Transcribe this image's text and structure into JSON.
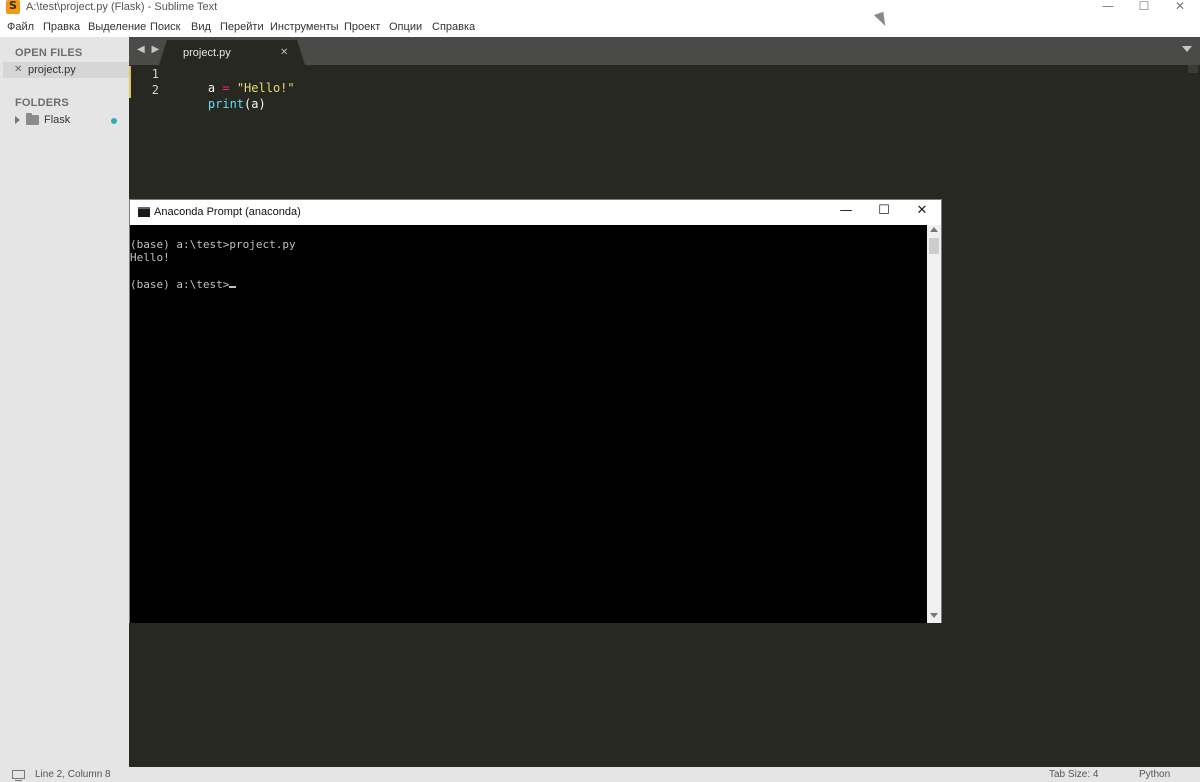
{
  "window": {
    "title": "A:\\test\\project.py (Flask) - Sublime Text",
    "minimize_glyph": "—",
    "maximize_glyph": "☐",
    "close_glyph": "✕",
    "icon": "sublime-text-icon"
  },
  "menu": {
    "items": [
      "Файл",
      "Правка",
      "Выделение",
      "Поиск",
      "Вид",
      "Перейти",
      "Инструменты",
      "Проект",
      "Опции",
      "Справка"
    ]
  },
  "sidebar": {
    "open_files_heading": "OPEN FILES",
    "open_files": [
      {
        "close_glyph": "✕",
        "name": "project.py"
      }
    ],
    "folders_heading": "FOLDERS",
    "folders": [
      {
        "name": "Flask",
        "icon": "folder-icon",
        "status_color": "#33aabb"
      }
    ]
  },
  "tabbar": {
    "nav_glyph": "◀ ▶",
    "tabs": [
      {
        "label": "project.py",
        "close_glyph": "✕",
        "active": true
      }
    ],
    "menu_icon": "chevron-down-icon"
  },
  "editor": {
    "line_numbers": [
      "1",
      "2"
    ],
    "lines": [
      [
        {
          "text": "a ",
          "kind": "plain"
        },
        {
          "text": "=",
          "kind": "op"
        },
        {
          "text": " ",
          "kind": "plain"
        },
        {
          "text": "\"Hello!\"",
          "kind": "str"
        }
      ],
      [
        {
          "text": "print",
          "kind": "fn"
        },
        {
          "text": "(a)",
          "kind": "plain"
        }
      ]
    ],
    "theme_colors": {
      "background": "#272822",
      "keyword": "#f92672",
      "string": "#e6db74",
      "function": "#66d9ef"
    }
  },
  "console": {
    "title": "Anaconda Prompt (anaconda)",
    "minimize_glyph": "—",
    "maximize_glyph": "☐",
    "close_glyph": "✕",
    "lines": [
      "(base) a:\\test>project.py",
      "Hello!",
      "",
      "(base) a:\\test>"
    ]
  },
  "statusbar": {
    "position": "Line 2, Column 8",
    "tab_size": "Tab Size: 4",
    "syntax": "Python"
  }
}
